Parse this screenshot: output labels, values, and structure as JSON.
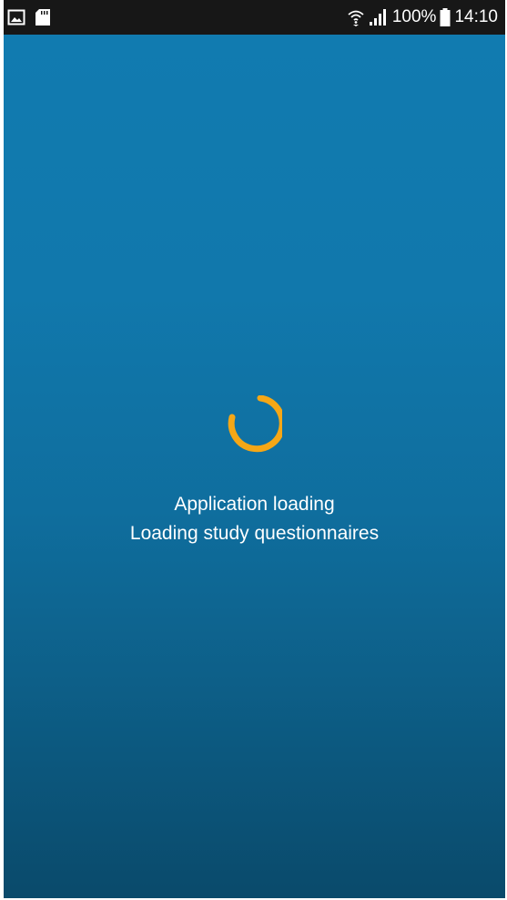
{
  "status_bar": {
    "battery": "100%",
    "time": "14:10",
    "icons": {
      "left": [
        "gallery-icon",
        "sd-card-icon"
      ],
      "right": [
        "wifi-icon",
        "signal-icon",
        "battery-icon"
      ]
    },
    "background": "#171717"
  },
  "screen": {
    "gradient_top": "#117bb0",
    "gradient_bottom": "#0a4a6b",
    "spinner_color": "#f5a716",
    "loading_title": "Application loading",
    "loading_detail": "Loading study questionnaires"
  }
}
